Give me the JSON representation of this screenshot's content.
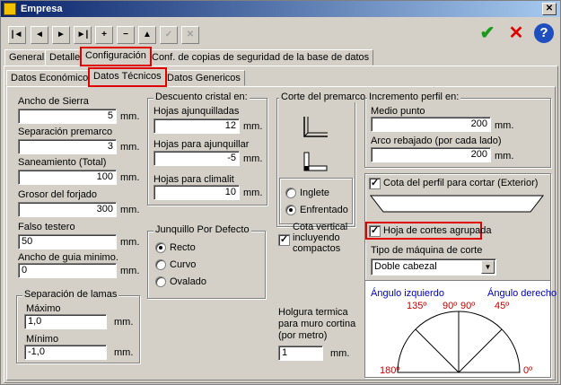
{
  "window": {
    "title": "Empresa",
    "close_glyph": "✕"
  },
  "toolbar": {
    "nav": [
      "|◄",
      "◄",
      "►",
      "►|",
      "+",
      "−",
      "▲",
      "✓",
      "✕"
    ],
    "ok_glyph": "✔",
    "cancel_glyph": "✕",
    "help_glyph": "?"
  },
  "tabs_main": [
    "General",
    "Detalle",
    "Configuración",
    "Conf. de copias de seguridad de la base de datos"
  ],
  "tabs_sub": [
    "Datos Económicos",
    "Datos Técnicos",
    "Datos Genericos"
  ],
  "left": {
    "ancho_sierra": {
      "label": "Ancho de Sierra",
      "value": "5",
      "unit": "mm."
    },
    "separacion_premarco": {
      "label": "Separación premarco",
      "value": "3",
      "unit": "mm."
    },
    "saneamiento": {
      "label": "Saneamiento (Total)",
      "value": "100",
      "unit": "mm."
    },
    "grosor_forjado": {
      "label": "Grosor del forjado",
      "value": "300",
      "unit": "mm."
    },
    "falso_testero": {
      "label": "Falso testero",
      "value": "50",
      "unit": "mm."
    },
    "ancho_guia": {
      "label": "Ancho de guia minimo.",
      "value": "0",
      "unit": "mm."
    },
    "separacion_lamas": {
      "title": "Separación de lamas",
      "maximo": {
        "label": "Máximo",
        "value": "1,0",
        "unit": "mm."
      },
      "minimo": {
        "label": "Mínimo",
        "value": "-1,0",
        "unit": "mm."
      }
    }
  },
  "descuento": {
    "title": "Descuento cristal en:",
    "ajunquilladas": {
      "label": "Hojas ajunquilladas",
      "value": "12",
      "unit": "mm."
    },
    "para_ajunquillar": {
      "label": "Hojas para ajunquillar",
      "value": "-5",
      "unit": "mm."
    },
    "para_climalit": {
      "label": "Hojas para climalit",
      "value": "10",
      "unit": "mm."
    }
  },
  "junquillo": {
    "title": "Junquillo Por Defecto",
    "options": [
      "Recto",
      "Curvo",
      "Ovalado"
    ],
    "selected": 0
  },
  "premarco": {
    "title": "Corte del premarco",
    "options": [
      "Inglete",
      "Enfrentado"
    ],
    "selected": 1
  },
  "cota_vertical": {
    "label": "Cota vertical incluyendo compactos",
    "checked": true
  },
  "holgura": {
    "label": "Holgura termica para muro cortina (por metro)",
    "value": "1",
    "unit": "mm."
  },
  "incremento": {
    "title": "Incremento perfil en:",
    "medio_punto": {
      "label": "Medio punto",
      "value": "200",
      "unit": "mm."
    },
    "arco_rebajado": {
      "label": "Arco rebajado (por cada lado)",
      "value": "200",
      "unit": "mm."
    }
  },
  "corte": {
    "cota_perfil": {
      "label": "Cota del perfil para cortar (Exterior)",
      "checked": true
    },
    "hoja_agrupada": {
      "label": "Hoja de cortes agrupada",
      "checked": true
    },
    "tipo_maquina_label": "Tipo de máquina de corte",
    "tipo_maquina_value": "Doble cabezal",
    "angulo_izq": "Ángulo izquierdo",
    "angulo_der": "Ángulo derecho",
    "angles": [
      "135º",
      "90º",
      "90º",
      "45º",
      "180º",
      "0º"
    ]
  },
  "colors": {
    "ok_green": "#1a9a1a",
    "cancel_red": "#e00000",
    "help_blue": "#1f4fbf",
    "protractor_label_blue": "#0000c8",
    "protractor_value_red": "#c80000",
    "highlight_red": "#e00000"
  },
  "icons": [
    "app-icon",
    "close-icon",
    "first-icon",
    "prev-icon",
    "next-icon",
    "last-icon",
    "add-icon",
    "remove-icon",
    "up-icon",
    "confirm-icon",
    "discard-icon",
    "ok-icon",
    "cancel-icon",
    "help-icon",
    "chevron-down-icon"
  ]
}
